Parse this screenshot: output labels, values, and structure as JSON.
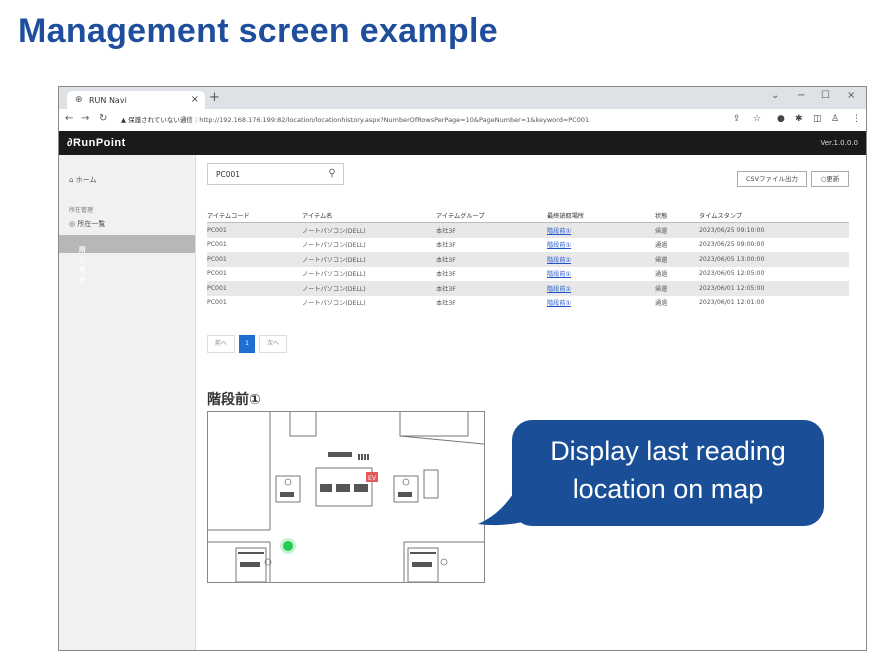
{
  "slide": {
    "title": "Management screen example"
  },
  "browser": {
    "tab_title": "RUN Navi",
    "tab_close": "×",
    "new_tab": "+",
    "url_warning": "▲ 保護されていない通信",
    "url": "http://192.168.176.199:82/location/locationhistory.aspx?NumberOfRowsPerPage=10&PageNumber=1&keyword=PC001"
  },
  "app": {
    "logo": "RunPoint",
    "version": "Ver.1.0.0.0"
  },
  "sidebar": {
    "home": "ホーム",
    "group": "所在管理",
    "items": [
      {
        "label": "所在一覧"
      },
      {
        "label": "所在履歴"
      }
    ]
  },
  "search": {
    "value": "PC001"
  },
  "buttons": {
    "csv": "CSVファイル出力",
    "refresh": "○更新"
  },
  "table": {
    "headers": [
      "アイテムコード",
      "アイテム名",
      "アイテムグループ",
      "最終読取場所",
      "状態",
      "タイムスタンプ"
    ],
    "rows": [
      [
        "PC001",
        "ノートパソコン(DELL)",
        "本社3F",
        "階段前①",
        "帰還",
        "2023/06/25 09:10:00"
      ],
      [
        "PC001",
        "ノートパソコン(DELL)",
        "本社3F",
        "階段前①",
        "通過",
        "2023/06/25 09:00:00"
      ],
      [
        "PC001",
        "ノートパソコン(DELL)",
        "本社3F",
        "階段前①",
        "帰還",
        "2023/06/05 13:00:00"
      ],
      [
        "PC001",
        "ノートパソコン(DELL)",
        "本社3F",
        "階段前①",
        "通過",
        "2023/06/05 12:05:00"
      ],
      [
        "PC001",
        "ノートパソコン(DELL)",
        "本社3F",
        "階段前①",
        "帰還",
        "2023/06/01 12:05:00"
      ],
      [
        "PC001",
        "ノートパソコン(DELL)",
        "本社3F",
        "階段前①",
        "通過",
        "2023/06/01 12:01:00"
      ]
    ]
  },
  "pager": {
    "prev": "前へ",
    "current": "1",
    "next": "次へ"
  },
  "map": {
    "title": "階段前①",
    "elevator_label": "EV"
  },
  "callout": {
    "line1": "Display last reading",
    "line2": "location on map"
  },
  "colors": {
    "title_blue": "#1f4e9c",
    "callout_blue": "#1a4f97",
    "marker_green": "#22cc55"
  }
}
